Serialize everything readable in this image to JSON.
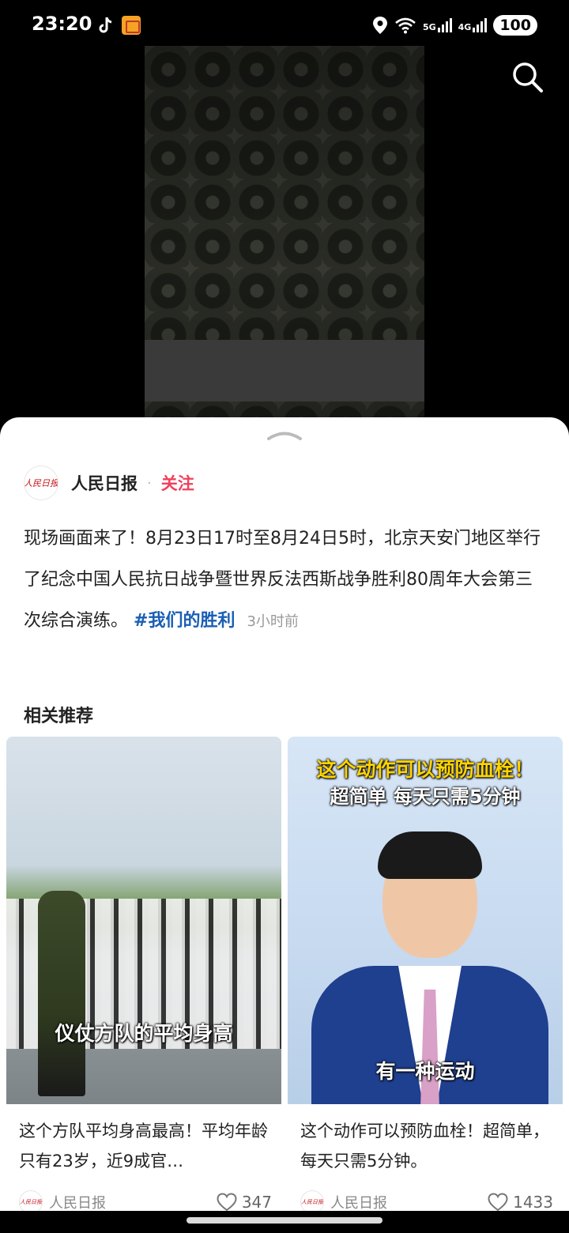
{
  "status_bar": {
    "time": "23:20",
    "network_labels": [
      "5G",
      "4G"
    ],
    "battery": "100",
    "icons": [
      "tiktok-icon",
      "notification-app-icon",
      "location-icon",
      "wifi-icon",
      "cell-signal-icon",
      "battery-icon"
    ]
  },
  "video": {
    "search_icon": "search-icon"
  },
  "post": {
    "author": "人民日报",
    "follow_label": "关注",
    "dot": "·",
    "text": "现场画面来了！8月23日17时至8月24日5时，北京天安门地区举行了纪念中国人民抗日战争暨世界反法西斯战争胜利80周年大会第三次综合演练。",
    "hashtag": "#我们的胜利",
    "time_ago": "3小时前"
  },
  "related": {
    "title": "相关推荐",
    "cards": [
      {
        "overlay_caption": "仪仗方队的平均身高",
        "title": "这个方队平均身高最高！平均年龄只有23岁，近9成官…",
        "author": "人民日报",
        "likes": "347"
      },
      {
        "overlay_top_1": "这个动作可以预防血栓！",
        "overlay_top_2": "超简单 每天只需5分钟",
        "overlay_caption": "有一种运动",
        "title": "这个动作可以预防血栓！超简单，每天只需5分钟。",
        "author": "人民日报",
        "likes": "1433"
      }
    ]
  },
  "colors": {
    "follow": "#f0405a",
    "hashtag": "#1a5fb4",
    "logo_red": "#c8161d"
  }
}
